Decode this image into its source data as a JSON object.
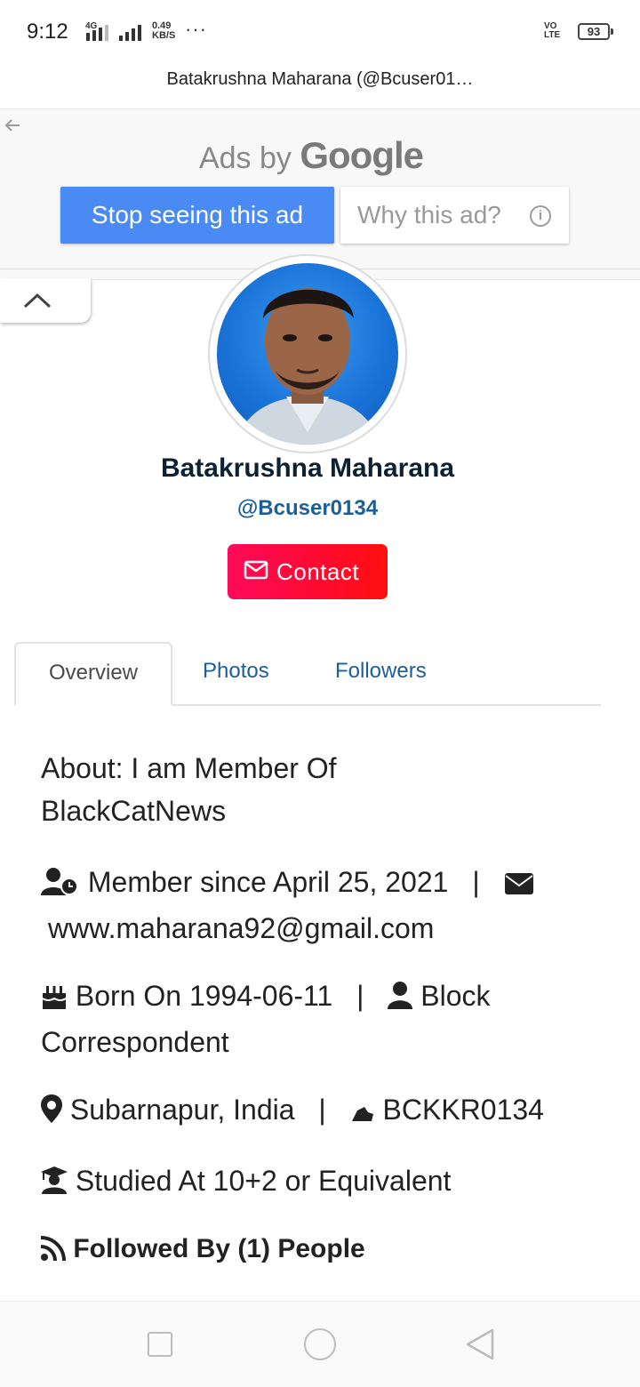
{
  "status_bar": {
    "time": "9:12",
    "network_label": "4G",
    "speed_value": "0.49",
    "speed_unit": "KB/S",
    "more": "···",
    "volte_top": "VO",
    "volte_bottom": "LTE",
    "battery": "93"
  },
  "page": {
    "title": "Batakrushna Maharana (@Bcuser01…"
  },
  "ad": {
    "ads_by": "Ads by",
    "brand": "Google",
    "stop_label": "Stop seeing this ad",
    "why_label": "Why this ad?",
    "info_glyph": "i"
  },
  "profile": {
    "name": "Batakrushna Maharana",
    "handle": "@Bcuser0134",
    "contact_label": "Contact"
  },
  "tabs": [
    {
      "label": "Overview",
      "active": true
    },
    {
      "label": "Photos",
      "active": false
    },
    {
      "label": "Followers",
      "active": false
    }
  ],
  "details": {
    "about_line1": "About: I am Member Of",
    "about_line2": "BlackCatNews",
    "member_since": "Member since April 25, 2021",
    "separator": "|",
    "email": "www.maharana92@gmail.com",
    "born": "Born On 1994-06-11",
    "role_line1": "Block",
    "role_line2": "Correspondent",
    "location": "Subarnapur, India",
    "code": "BCKKR0134",
    "studied": "Studied At 10+2 or Equivalent",
    "followed_by": "Followed By (1) People"
  },
  "colors": {
    "ad_blue": "#4a8af4",
    "contact_red": "#ff0a3c",
    "link_blue": "#1a5f99",
    "name_dark": "#0c2233"
  },
  "icons": [
    "back-arrow-icon",
    "info-icon",
    "chevron-up-icon",
    "envelope-icon",
    "user-clock-icon",
    "birthday-cake-icon",
    "user-icon",
    "map-marker-icon",
    "hand-point-icon",
    "graduate-icon",
    "rss-icon"
  ]
}
